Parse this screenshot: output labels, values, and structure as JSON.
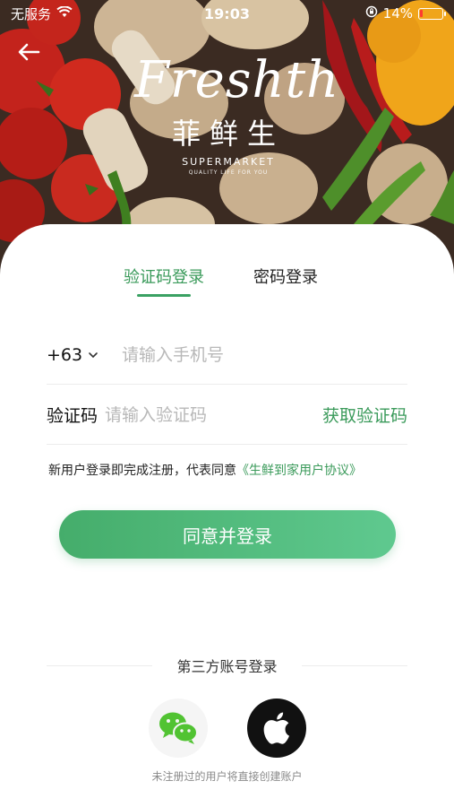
{
  "status_bar": {
    "carrier": "无服务",
    "time": "19:03",
    "battery_percent": "14%",
    "battery_level": 0.14,
    "icons": [
      "wifi-icon",
      "orientation-lock-icon",
      "battery-icon"
    ]
  },
  "brand": {
    "script": "Freshth",
    "cn_name": "菲鲜生",
    "subtitle": "SUPERMARKET",
    "tagline": "QUALITY LIFE FOR YOU"
  },
  "tabs": {
    "active": "验证码登录",
    "inactive": "密码登录"
  },
  "phone_row": {
    "country_code": "+63",
    "placeholder": "请输入手机号"
  },
  "code_row": {
    "label": "验证码",
    "placeholder": "请输入验证码",
    "get_code": "获取验证码"
  },
  "agreement": {
    "text": "新用户登录即完成注册，代表同意",
    "link": "《生鲜到家用户协议》"
  },
  "login_button": "同意并登录",
  "third_party": {
    "title": "第三方账号登录",
    "providers": [
      "wechat-icon",
      "apple-icon"
    ]
  },
  "footnote": "未注册过的用户将直接创建账户",
  "colors": {
    "accent": "#3a9a5a",
    "button_start": "#45ad6b",
    "button_end": "#5fc98f"
  }
}
